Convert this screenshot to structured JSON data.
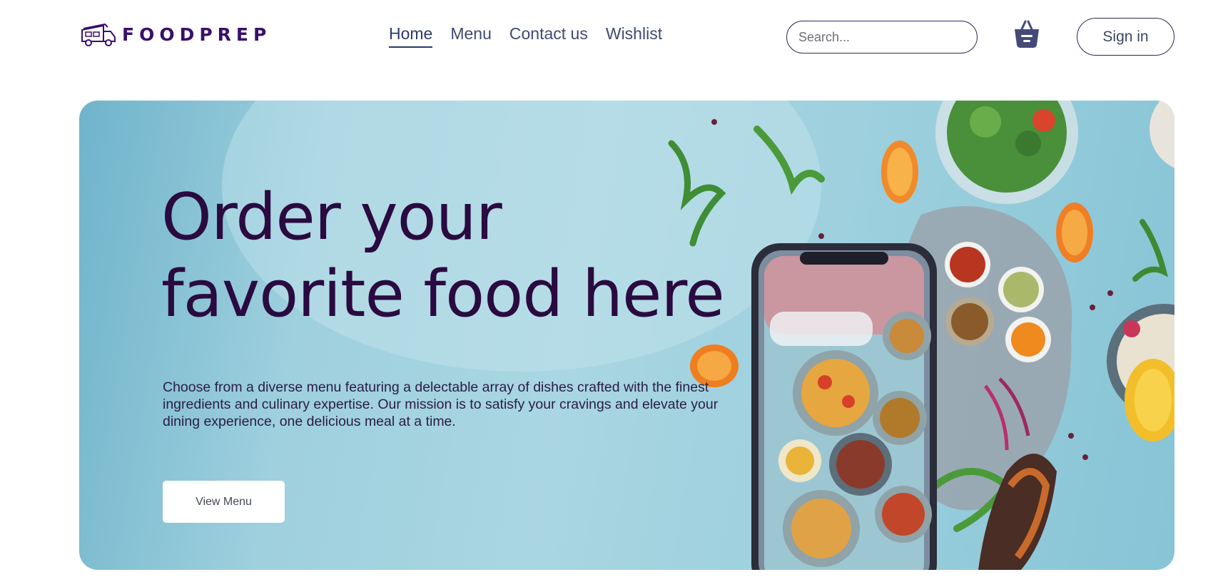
{
  "brand": {
    "name": "FOODPREP",
    "logo_icon": "food-truck-icon",
    "color": "#3a0f6b"
  },
  "nav": {
    "items": [
      {
        "label": "Home",
        "active": true
      },
      {
        "label": "Menu",
        "active": false
      },
      {
        "label": "Contact us",
        "active": false
      },
      {
        "label": "Wishlist",
        "active": false
      }
    ]
  },
  "search": {
    "placeholder": "Search..."
  },
  "cart": {
    "icon": "basket-icon"
  },
  "auth": {
    "signin_label": "Sign in"
  },
  "hero": {
    "title": "Order your favorite food here",
    "description": "Choose from a diverse menu featuring a delectable array of dishes crafted with the finest ingredients and culinary expertise. Our mission is to satisfy your cravings and elevate your dining experience, one delicious meal at a time.",
    "cta_label": "View Menu"
  },
  "colors": {
    "title": "#2a0a40",
    "hero_bg": "#a9d6e2",
    "nav": "#404a70"
  }
}
